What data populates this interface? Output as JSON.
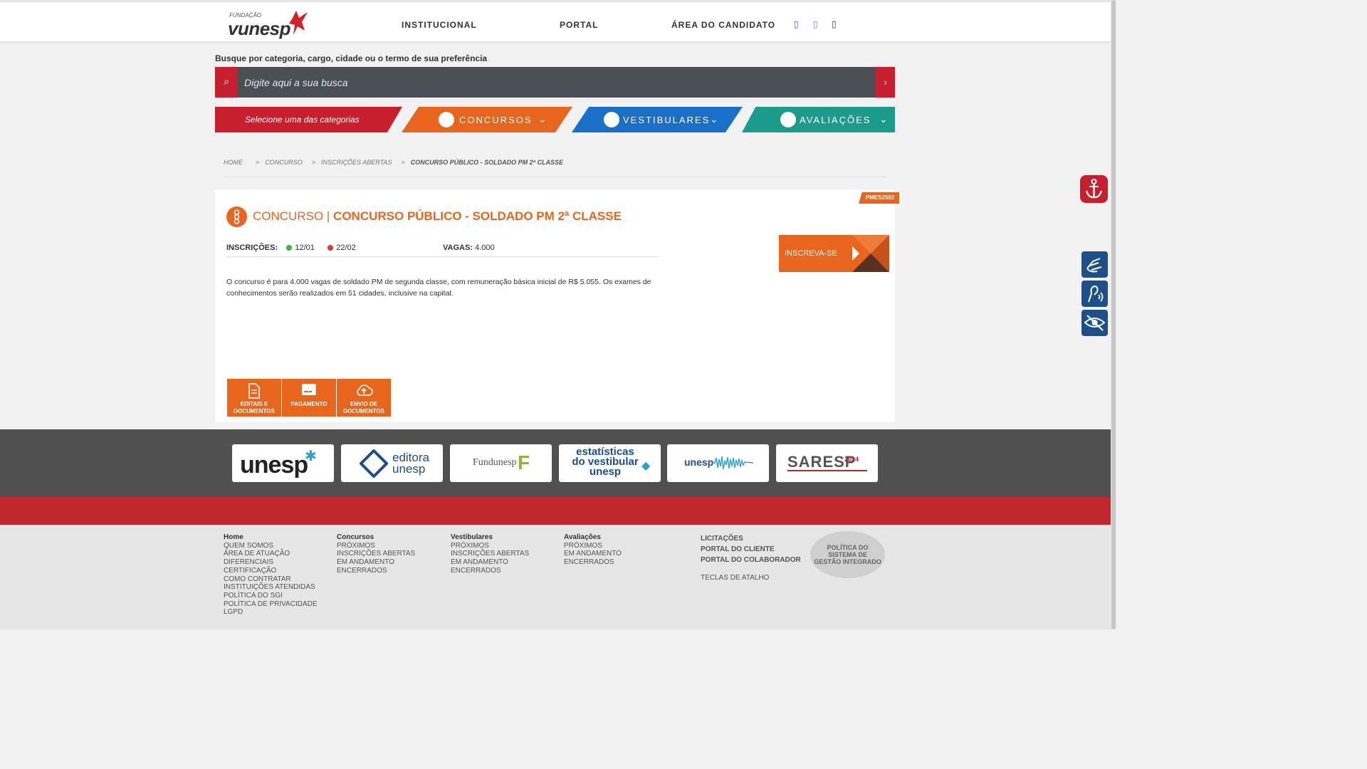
{
  "header": {
    "logo_small": "FUNDAÇÃO",
    "logo_main": "vunesp",
    "nav": [
      "INSTITUCIONAL",
      "PORTAL",
      "ÁREA DO CANDIDATO"
    ],
    "icons": [
      "facebook-icon",
      "twitter-icon",
      "instagram-icon"
    ]
  },
  "search": {
    "caption": "Busque por categoria, cargo, cidade ou o termo de sua preferência",
    "placeholder": "Digite aqui a sua busca",
    "left_icon": "⌕",
    "right_icon": "›"
  },
  "categories": {
    "select_label": "Selecione uma das categorias",
    "items": [
      {
        "label": "CONCURSOS",
        "color": "#e8651d"
      },
      {
        "label": "VESTIBULARES",
        "color": "#1a6fc9"
      },
      {
        "label": "AVALIAÇÕES",
        "color": "#1a9b8c"
      }
    ]
  },
  "breadcrumb": {
    "items": [
      "HOME",
      "CONCURSO",
      "INSCRIÇÕES ABERTAS"
    ],
    "current": "CONCURSO PÚBLICO - SOLDADO PM 2ª CLASSE"
  },
  "exam": {
    "code": "PMES2502",
    "category": "CONCURSO |",
    "title": "CONCURSO PÚBLICO - SOLDADO PM 2ª CLASSE",
    "inscricoes_label": "INSCRIÇÕES:",
    "date_start": "12/01",
    "date_end": "22/02",
    "vagas_label": "VAGAS:",
    "vagas": "4.000",
    "cta": "INSCREVA-SE",
    "description": "O concurso é para 4.000 vagas de soldado PM de segunda classe, com remuneração básica inicial de R$ 5.055. Os exames de conhecimentos serão realizados em 51 cidades, inclusive na capital.",
    "doc_buttons": [
      {
        "line1": "EDITAIS E",
        "line2": "DOCUMENTOS"
      },
      {
        "line1": "PAGAMENTO",
        "line2": ""
      },
      {
        "line1": "ENVIO DE",
        "line2": "DOCUMENTOS"
      }
    ],
    "status_colors": {
      "start": "#3db33d",
      "end": "#e8323c"
    }
  },
  "partners": {
    "unesp": "unesp",
    "editora_1": "editora",
    "editora_2": "unesp",
    "fundunesp": "Fundunesp",
    "estatisticas_1": "estatísticas",
    "estatisticas_2": "do vestibular",
    "estatisticas_3": "unesp",
    "podcast": "unesp",
    "saresp": "SARESP",
    "saresp_year": "2024"
  },
  "footer": {
    "col1": {
      "head": "Home",
      "items": [
        "QUEM SOMOS",
        "ÁREA DE ATUAÇÃO",
        "DIFERENCIAIS",
        "CERTIFICAÇÃO",
        "COMO CONTRATAR",
        "INSTITUIÇÕES ATENDIDAS",
        "POLÍTICA DO SGI",
        "POLÍTICA DE PRIVACIDADE",
        "LGPD"
      ]
    },
    "col2": {
      "head": "Concursos",
      "items": [
        "PRÓXIMOS",
        "INSCRIÇÕES ABERTAS",
        "EM ANDAMENTO",
        "ENCERRADOS"
      ]
    },
    "col3": {
      "head": "Vestibulares",
      "items": [
        "PRÓXIMOS",
        "INSCRIÇÕES ABERTAS",
        "EM ANDAMENTO",
        "ENCERRADOS"
      ]
    },
    "col4": {
      "head": "Avaliações",
      "items": [
        "PRÓXIMOS",
        "EM ANDAMENTO",
        "ENCERRADOS"
      ]
    },
    "links": [
      "LICITAÇÕES",
      "PORTAL DO CLIENTE",
      "PORTAL DO COLABORADOR"
    ],
    "shortcut": "TECLAS DE ATALHO",
    "sgi": [
      "POLÍTICA DO",
      "SISTEMA DE",
      "GESTÃO INTEGRADO"
    ]
  }
}
